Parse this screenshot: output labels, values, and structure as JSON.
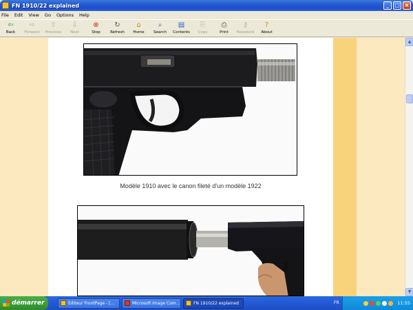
{
  "window": {
    "title": "FN 1910/22 explained"
  },
  "menu": [
    "File",
    "Edit",
    "View",
    "Go",
    "Options",
    "Help"
  ],
  "toolbar": [
    {
      "label": "Back",
      "icon": "back-arrow-icon",
      "glyph": "⇦",
      "enabled": true,
      "color": "green"
    },
    {
      "label": "Forward",
      "icon": "forward-arrow-icon",
      "glyph": "⇨",
      "enabled": false,
      "color": "gray"
    },
    {
      "label": "Previous",
      "icon": "previous-icon",
      "glyph": "⇧",
      "enabled": false,
      "color": "gray"
    },
    {
      "label": "Next",
      "icon": "next-icon",
      "glyph": "⇩",
      "enabled": false,
      "color": "gray"
    },
    {
      "label": "Stop",
      "icon": "stop-icon",
      "glyph": "⊗",
      "enabled": true,
      "color": "red"
    },
    {
      "label": "Refresh",
      "icon": "refresh-icon",
      "glyph": "↻",
      "enabled": true,
      "color": "gray"
    },
    {
      "label": "Home",
      "icon": "home-icon",
      "glyph": "⌂",
      "enabled": true,
      "color": "orange"
    },
    {
      "label": "Search",
      "icon": "search-icon",
      "glyph": "⌕",
      "enabled": true,
      "color": "blue"
    },
    {
      "label": "Contents",
      "icon": "contents-icon",
      "glyph": "▤",
      "enabled": true,
      "color": "blue"
    },
    {
      "label": "Copy",
      "icon": "copy-icon",
      "glyph": "⎘",
      "enabled": false,
      "color": "gray"
    },
    {
      "label": "Print",
      "icon": "print-icon",
      "glyph": "⎙",
      "enabled": true,
      "color": "gray"
    },
    {
      "label": "Password",
      "icon": "password-key-icon",
      "glyph": "⚷",
      "enabled": false,
      "color": "gray"
    },
    {
      "label": "About",
      "icon": "about-icon",
      "glyph": "?",
      "enabled": true,
      "color": "orange"
    }
  ],
  "content": {
    "caption": "Modèle 1910 avec le canon fileté d'un modèle 1922"
  },
  "taskbar": {
    "start_label": "démarrer",
    "tasks": [
      {
        "label": "Éditeur FrontPage - [...",
        "active": false
      },
      {
        "label": "Microsoft Image Com...",
        "active": false
      },
      {
        "label": "FN 1910/22 explained",
        "active": true
      }
    ],
    "tray_lang": "FR",
    "time": "11:55"
  },
  "colors": {
    "page_bg": "#ffffff",
    "side_bg": "#fde9bf",
    "side_accent": "#f9d27c",
    "titlebar": "#2458d6",
    "start_button": "#3a9a37"
  }
}
